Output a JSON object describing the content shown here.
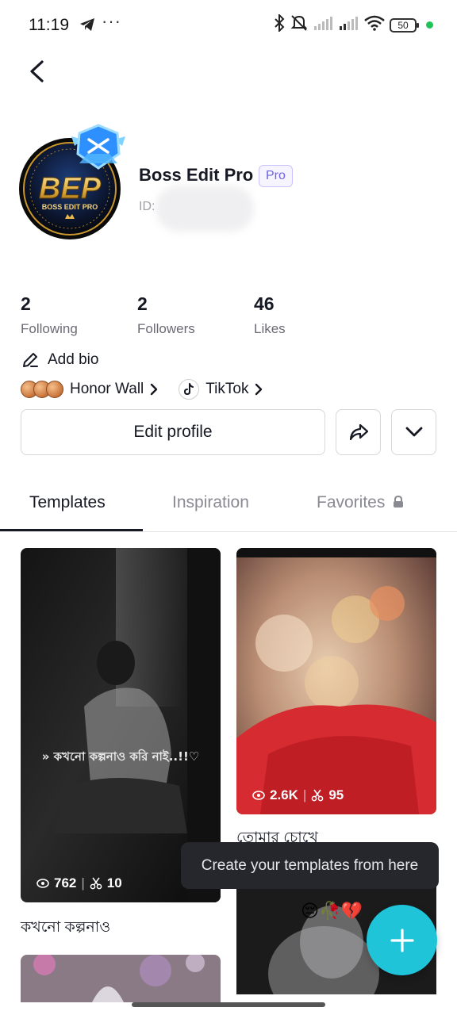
{
  "status_bar": {
    "time": "11:19",
    "dots": "···",
    "battery": "50"
  },
  "profile": {
    "name": "Boss Edit Pro",
    "badge": "Pro",
    "id_label": "ID:",
    "avatar_logo_text": "BEP",
    "avatar_logo_subtext": "BOSS EDIT PRO"
  },
  "stats": [
    {
      "value": "2",
      "label": "Following"
    },
    {
      "value": "2",
      "label": "Followers"
    },
    {
      "value": "46",
      "label": "Likes"
    }
  ],
  "add_bio": "Add bio",
  "honor_wall": "Honor Wall",
  "tiktok": "TikTok",
  "buttons": {
    "edit_profile": "Edit profile"
  },
  "tabs": [
    {
      "label": "Templates",
      "active": true
    },
    {
      "label": "Inspiration",
      "active": false
    },
    {
      "label": "Favorites",
      "active": false,
      "locked": true
    }
  ],
  "templates": [
    {
      "views": "762",
      "uses": "10",
      "title": "কখনো কল্পনাও",
      "overlay_text": "» কখনো কল্পনাও করি নাই..!!♡"
    },
    {
      "views": "2.6K",
      "uses": "95",
      "title": "তোমার চোখে"
    },
    {
      "title": ""
    },
    {
      "overlay_text": "😔🥀💔"
    }
  ],
  "tooltip": "Create your templates from here",
  "colors": {
    "accent": "#1fc4d8",
    "pro": "#6e63e6",
    "tooltip_bg": "#26272d"
  }
}
